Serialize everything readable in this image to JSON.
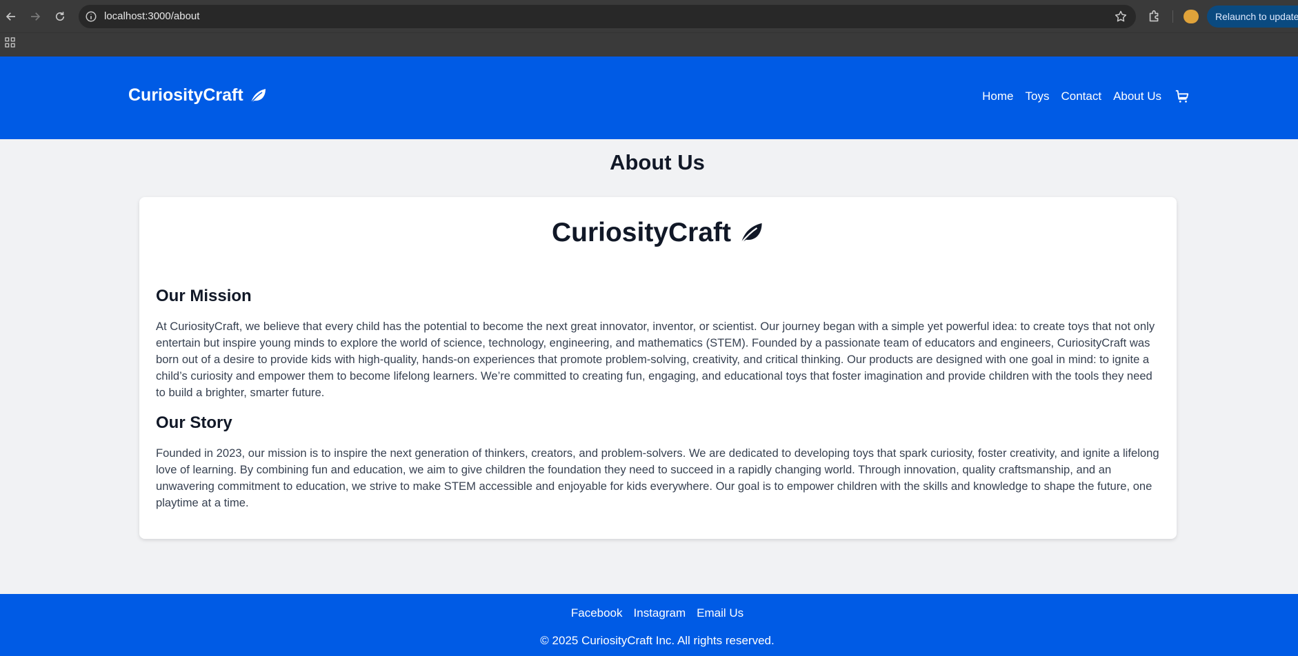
{
  "browser": {
    "url": "localhost:3000/about",
    "relaunch_label": "Relaunch to update"
  },
  "header": {
    "brand": "CuriosityCraft",
    "nav": [
      "Home",
      "Toys",
      "Contact",
      "About Us"
    ]
  },
  "main": {
    "title": "About Us",
    "card_brand": "CuriosityCraft",
    "mission_title": "Our Mission",
    "mission_text": "At CuriosityCraft, we believe that every child has the potential to become the next great innovator, inventor, or scientist. Our journey began with a simple yet powerful idea: to create toys that not only entertain but inspire young minds to explore the world of science, technology, engineering, and mathematics (STEM). Founded by a passionate team of educators and engineers, CuriosityCraft was born out of a desire to provide kids with high-quality, hands-on experiences that promote problem-solving, creativity, and critical thinking. Our products are designed with one goal in mind: to ignite a child’s curiosity and empower them to become lifelong learners. We’re committed to creating fun, engaging, and educational toys that foster imagination and provide children with the tools they need to build a brighter, smarter future.",
    "story_title": "Our Story",
    "story_text": "Founded in 2023, our mission is to inspire the next generation of thinkers, creators, and problem-solvers. We are dedicated to developing toys that spark curiosity, foster creativity, and ignite a lifelong love of learning. By combining fun and education, we aim to give children the foundation they need to succeed in a rapidly changing world. Through innovation, quality craftsmanship, and an unwavering commitment to education, we strive to make STEM accessible and enjoyable for kids everywhere. Our goal is to empower children with the skills and knowledge to shape the future, one playtime at a time."
  },
  "footer": {
    "links": [
      "Facebook",
      "Instagram",
      "Email Us"
    ],
    "copyright": "© 2025 CuriosityCraft Inc. All rights reserved."
  },
  "colors": {
    "brand_blue": "#005be5",
    "page_bg": "#f1f2f4",
    "heading": "#111827",
    "body_text": "#374151"
  },
  "icons": [
    "back-icon",
    "forward-icon",
    "reload-icon",
    "info-icon",
    "star-icon",
    "extensions-icon",
    "apps-icon",
    "leaf-icon",
    "cart-icon"
  ]
}
